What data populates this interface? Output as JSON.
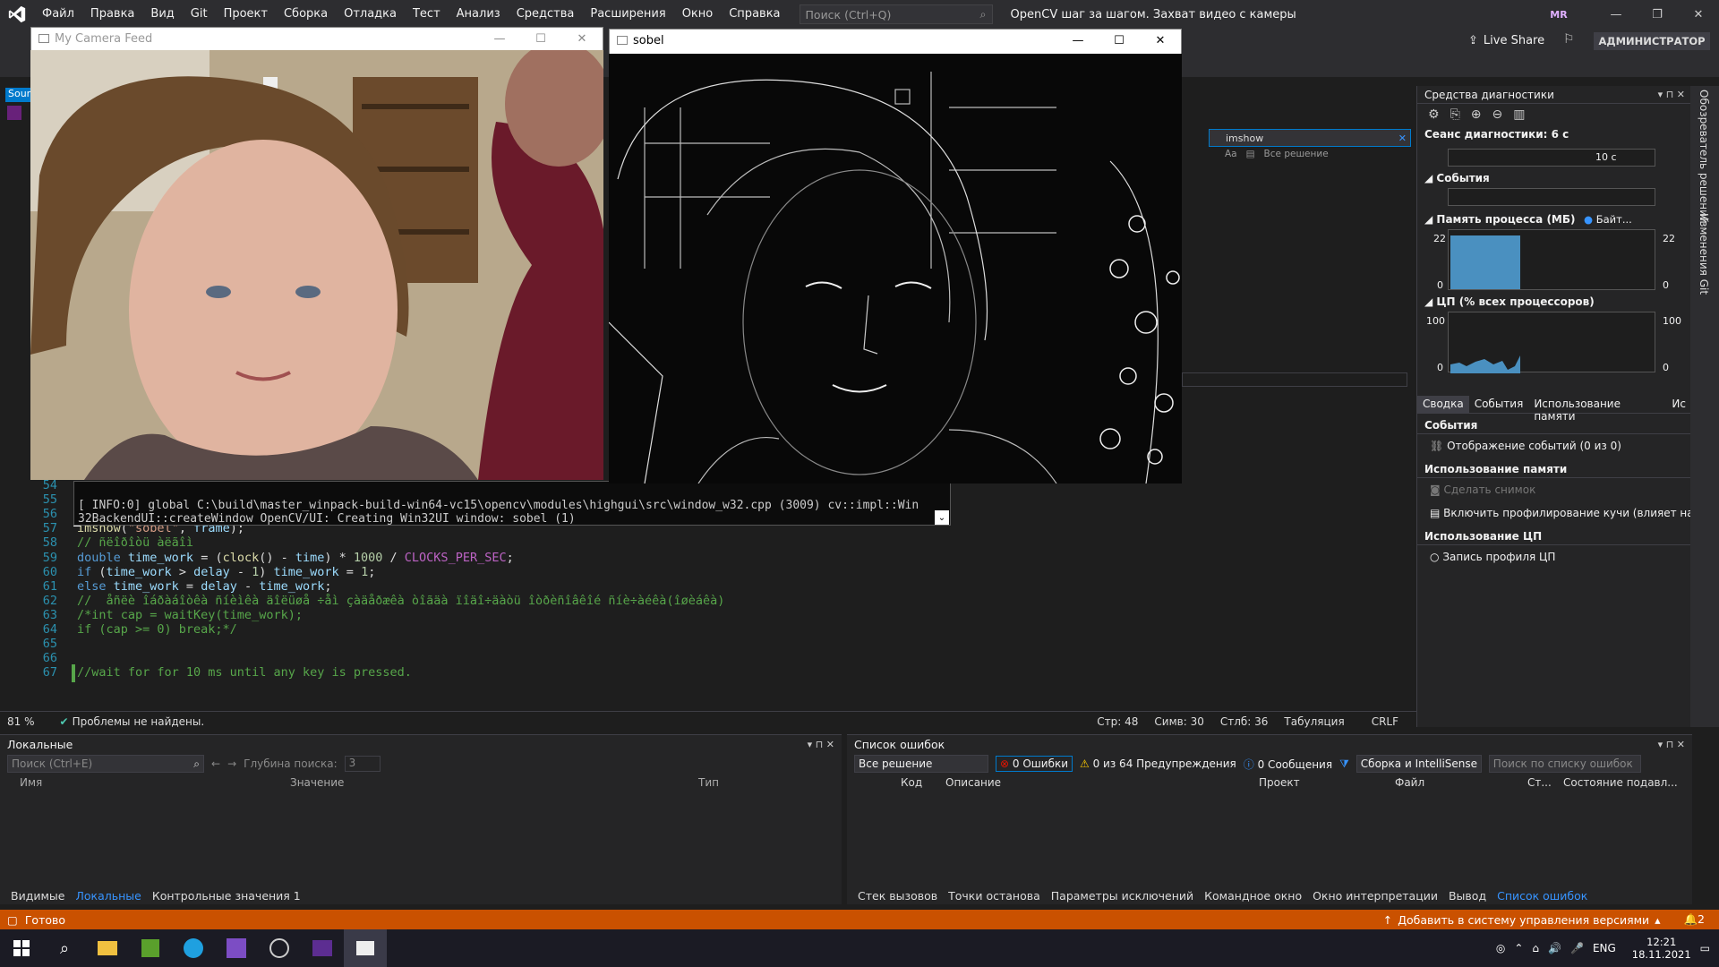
{
  "menu": {
    "items": [
      "Файл",
      "Правка",
      "Вид",
      "Git",
      "Проект",
      "Сборка",
      "Отладка",
      "Тест",
      "Анализ",
      "Средства",
      "Расширения",
      "Окно",
      "Справка"
    ],
    "search_placeholder": "Поиск (Ctrl+Q)",
    "solution_title": "OpenCV шаг за шагом. Захват видео с камеры",
    "user_initials": "MR"
  },
  "toolbar": {
    "live_share": "Live Share",
    "admin": "АДМИНИСТРАТОР"
  },
  "camera_window": {
    "title": "My Camera Feed"
  },
  "sobel_window": {
    "title": "sobel"
  },
  "console": {
    "line1": "[ INFO:0] global C:\\build\\master_winpack-build-win64-vc15\\opencv\\modules\\highgui\\src\\window_w32.cpp (3009) cv::impl::Win",
    "line2": "32BackendUI::createWindow OpenCV/UI: Creating Win32UI window: sobel (1)"
  },
  "editor": {
    "line_numbers": [
      "54",
      "55",
      "56",
      "57",
      "58",
      "59",
      "60",
      "61",
      "62",
      "63",
      "64",
      "65",
      "66",
      "67"
    ],
    "lines": [
      {
        "n": "57",
        "parts": [
          [
            "fn",
            "imshow"
          ],
          [
            "pl",
            "("
          ],
          [
            "str",
            "\"sobel\""
          ],
          [
            "pl",
            ", "
          ],
          [
            "id",
            "frame"
          ],
          [
            "pl",
            ");"
          ]
        ]
      },
      {
        "n": "58",
        "parts": [
          [
            "cm",
            "// ñëîðîòü àëãîì"
          ]
        ]
      },
      {
        "n": "59",
        "parts": [
          [
            "kw",
            "double "
          ],
          [
            "id",
            "time_work"
          ],
          [
            "pl",
            " = ("
          ],
          [
            "fn",
            "clock"
          ],
          [
            "pl",
            "() - "
          ],
          [
            "id",
            "time"
          ],
          [
            "pl",
            ") * "
          ],
          [
            "num",
            "1000"
          ],
          [
            "pl",
            " / "
          ],
          [
            "mac",
            "CLOCKS_PER_SEC"
          ],
          [
            "pl",
            ";"
          ]
        ]
      },
      {
        "n": "60",
        "parts": [
          [
            "kw",
            "if "
          ],
          [
            "pl",
            "("
          ],
          [
            "id",
            "time_work"
          ],
          [
            "pl",
            " > "
          ],
          [
            "id",
            "delay"
          ],
          [
            "pl",
            " - "
          ],
          [
            "num",
            "1"
          ],
          [
            "pl",
            ") "
          ],
          [
            "id",
            "time_work"
          ],
          [
            "pl",
            " = "
          ],
          [
            "num",
            "1"
          ],
          [
            "pl",
            ";"
          ]
        ]
      },
      {
        "n": "61",
        "parts": [
          [
            "kw",
            "else "
          ],
          [
            "id",
            "time_work"
          ],
          [
            "pl",
            " = "
          ],
          [
            "id",
            "delay"
          ],
          [
            "pl",
            " - "
          ],
          [
            "id",
            "time_work"
          ],
          [
            "pl",
            ";"
          ]
        ]
      },
      {
        "n": "62",
        "parts": [
          [
            "cm",
            "//  åñëè îáðàáîòêà ñíèìêà äîëüøå ÷åì çàäåðæêà òîãäà ïîäî÷äàòü îòðèñîâêîé ñíè÷àéêà(îøèáêà)"
          ]
        ]
      },
      {
        "n": "63",
        "parts": [
          [
            "cm",
            "/*int cap = waitKey(time_work);"
          ]
        ]
      },
      {
        "n": "64",
        "parts": [
          [
            "cm",
            "if (cap >= 0) break;*/"
          ]
        ]
      },
      {
        "n": "65",
        "parts": []
      },
      {
        "n": "66",
        "parts": []
      },
      {
        "n": "67",
        "parts": [
          [
            "cm",
            "//wait for for 10 ms until any key is pressed."
          ]
        ]
      }
    ],
    "zoom": "81 %",
    "problems": "Проблемы не найдены.",
    "position": {
      "line": "Стр: 48",
      "sym": "Симв: 30",
      "col": "Стлб: 36",
      "tabs": "Табуляция",
      "eol": "CRLF"
    }
  },
  "find": {
    "value": "imshow",
    "scope": "Все решение"
  },
  "diag": {
    "title": "Средства диагностики",
    "session": "Сеанс диагностики: 6 с",
    "timeline_label": "10 с",
    "events": "События",
    "memory": "Память процесса (МБ)",
    "memory_legend": "Байт...",
    "memory_max": "22",
    "memory_min": "0",
    "cpu": "ЦП (% всех процессоров)",
    "cpu_max": "100",
    "cpu_min": "0",
    "tabs": [
      "Сводка",
      "События",
      "Использование памяти",
      "Ис"
    ],
    "sections": {
      "events_h": "События",
      "events_item": "Отображение событий (0 из 0)",
      "mem_h": "Использование памяти",
      "mem_item1": "Сделать снимок",
      "mem_item2": "Включить профилирование кучи (влияет на пр",
      "cpu_h": "Использование ЦП",
      "cpu_item": "Запись профиля ЦП"
    }
  },
  "side_tabs": [
    "Обозреватель решений",
    "Изменения Git"
  ],
  "locals": {
    "title": "Локальные",
    "search_placeholder": "Поиск (Ctrl+E)",
    "depth_label": "Глубина поиска:",
    "depth_value": "3",
    "cols": [
      "Имя",
      "Значение",
      "Тип"
    ],
    "tabs": [
      "Видимые",
      "Локальные",
      "Контрольные значения 1"
    ]
  },
  "errors": {
    "title": "Список ошибок",
    "scope": "Все решение",
    "errors_count": "0 Ошибки",
    "warnings": "0 из 64 Предупреждения",
    "messages": "0 Сообщения",
    "build": "Сборка и IntelliSense",
    "search_placeholder": "Поиск по списку ошибок",
    "cols": [
      "Код",
      "Описание",
      "Проект",
      "Файл",
      "Ст...",
      "Состояние подавл..."
    ],
    "tabs": [
      "Стек вызовов",
      "Точки останова",
      "Параметры исключений",
      "Командное окно",
      "Окно интерпретации",
      "Вывод",
      "Список ошибок"
    ]
  },
  "status": {
    "ready": "Готово",
    "vcs": "Добавить в систему управления версиями",
    "notif": "2"
  },
  "taskbar": {
    "lang": "ENG",
    "time": "12:21",
    "date": "18.11.2021"
  },
  "colors": {
    "accent": "#007acc",
    "status": "#ca5100"
  }
}
